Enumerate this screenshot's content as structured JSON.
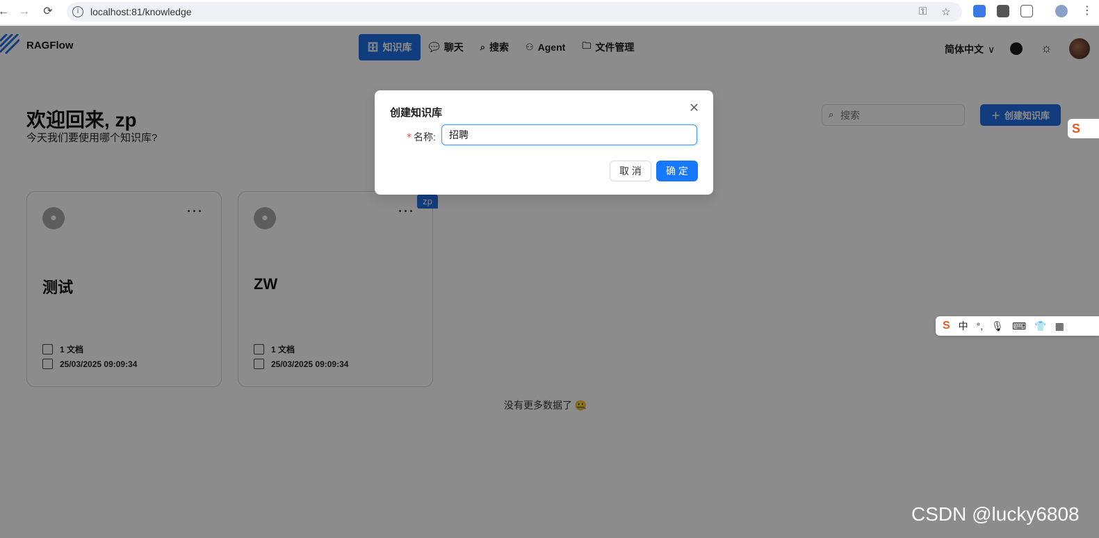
{
  "browser": {
    "url": "localhost:81/knowledge"
  },
  "header": {
    "brand": "RAGFlow",
    "nav": [
      {
        "label": "知识库",
        "icon": "database-icon",
        "active": true
      },
      {
        "label": "聊天",
        "icon": "chat-icon",
        "active": false
      },
      {
        "label": "搜索",
        "icon": "search-icon",
        "active": false
      },
      {
        "label": "Agent",
        "icon": "agent-icon",
        "active": false
      },
      {
        "label": "文件管理",
        "icon": "folder-icon",
        "active": false
      }
    ],
    "language": "简体中文"
  },
  "page": {
    "welcome": "欢迎回来, zp",
    "subtitle": "今天我们要使用哪个知识库?",
    "search_placeholder": "搜索",
    "create_button": "创建知识库",
    "no_more": "没有更多数据了 🤐"
  },
  "cards": [
    {
      "title": "测试",
      "docs": "1 文档",
      "date": "25/03/2025 09:09:34"
    },
    {
      "title": "ZW",
      "docs": "1 文档",
      "date": "25/03/2025 09:09:34",
      "owner_tag": "zp"
    }
  ],
  "modal": {
    "title": "创建知识库",
    "name_label": "名称:",
    "name_value": "招聘",
    "cancel": "取 消",
    "ok": "确 定"
  },
  "ime": {
    "mode": "中"
  },
  "watermark": "CSDN @lucky6808",
  "colors": {
    "primary": "#1f6fe5",
    "ok_button": "#1677ff",
    "required": "#ff4d4f"
  }
}
